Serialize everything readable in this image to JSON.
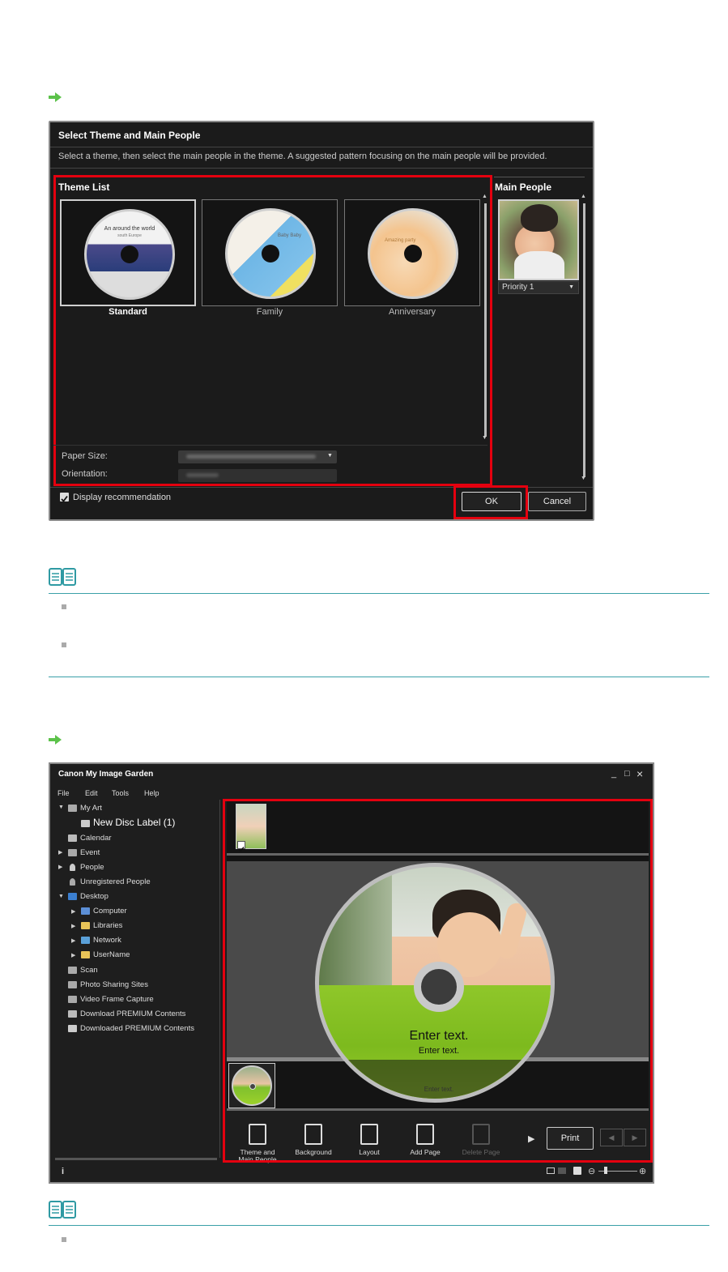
{
  "dialog": {
    "title": "Select Theme and Main People",
    "instruction": "Select a theme, then select the main people in the theme. A suggested pattern focusing on the main people will be provided.",
    "theme_list_heading": "Theme List",
    "themes": [
      {
        "label": "Standard",
        "disc_text": "An around the world",
        "disc_subtext": "south Europe",
        "selected": true
      },
      {
        "label": "Family",
        "disc_text": "Baby Baby",
        "selected": false
      },
      {
        "label": "Anniversary",
        "disc_text": "Amazing party",
        "selected": false
      }
    ],
    "main_people_heading": "Main People",
    "priority_value": "Priority 1",
    "paper_size_label": "Paper Size:",
    "orientation_label": "Orientation:",
    "display_recommendation_label": "Display recommendation",
    "display_recommendation_checked": true,
    "ok_label": "OK",
    "cancel_label": "Cancel"
  },
  "app": {
    "window_title": "Canon My Image Garden",
    "window_controls": [
      "_",
      "□",
      "×"
    ],
    "menu": [
      "File",
      "Edit",
      "Tools",
      "Help"
    ],
    "tree": [
      {
        "label": "My Art",
        "icon": "my-art-icon"
      },
      {
        "label": "New Disc Label (1)",
        "icon": "disc-label-icon"
      },
      {
        "label": "Calendar",
        "icon": "calendar-icon"
      },
      {
        "label": "Event",
        "icon": "event-icon"
      },
      {
        "label": "People",
        "icon": "person-icon"
      },
      {
        "label": "Unregistered People",
        "icon": "unregistered-person-icon"
      },
      {
        "label": "Desktop",
        "icon": "desktop-icon"
      },
      {
        "label": "Computer",
        "icon": "computer-icon"
      },
      {
        "label": "Libraries",
        "icon": "libraries-icon"
      },
      {
        "label": "Network",
        "icon": "network-icon"
      },
      {
        "label": "UserName",
        "icon": "user-folder-icon"
      },
      {
        "label": "Scan",
        "icon": "scan-icon"
      },
      {
        "label": "Photo Sharing Sites",
        "icon": "photo-sharing-icon"
      },
      {
        "label": "Video Frame Capture",
        "icon": "video-capture-icon"
      },
      {
        "label": "Download PREMIUM Contents",
        "icon": "download-icon"
      },
      {
        "label": "Downloaded PREMIUM Contents",
        "icon": "folder-icon"
      }
    ],
    "disc_title_text": "Enter text.",
    "disc_sub_text": "Enter text.",
    "thumb_disc_text": "Enter text.",
    "toolbar": {
      "theme_label": "Theme and Main People",
      "background_label": "Background",
      "layout_label": "Layout",
      "add_page_label": "Add Page",
      "delete_page_label": "Delete Page",
      "print_label": "Print"
    },
    "info_label": "i"
  },
  "colors": {
    "highlight": "#e4000f",
    "note_rule": "#3aa0a8",
    "arrow": "#5cc24a",
    "disc_green": "#8cc63f"
  }
}
